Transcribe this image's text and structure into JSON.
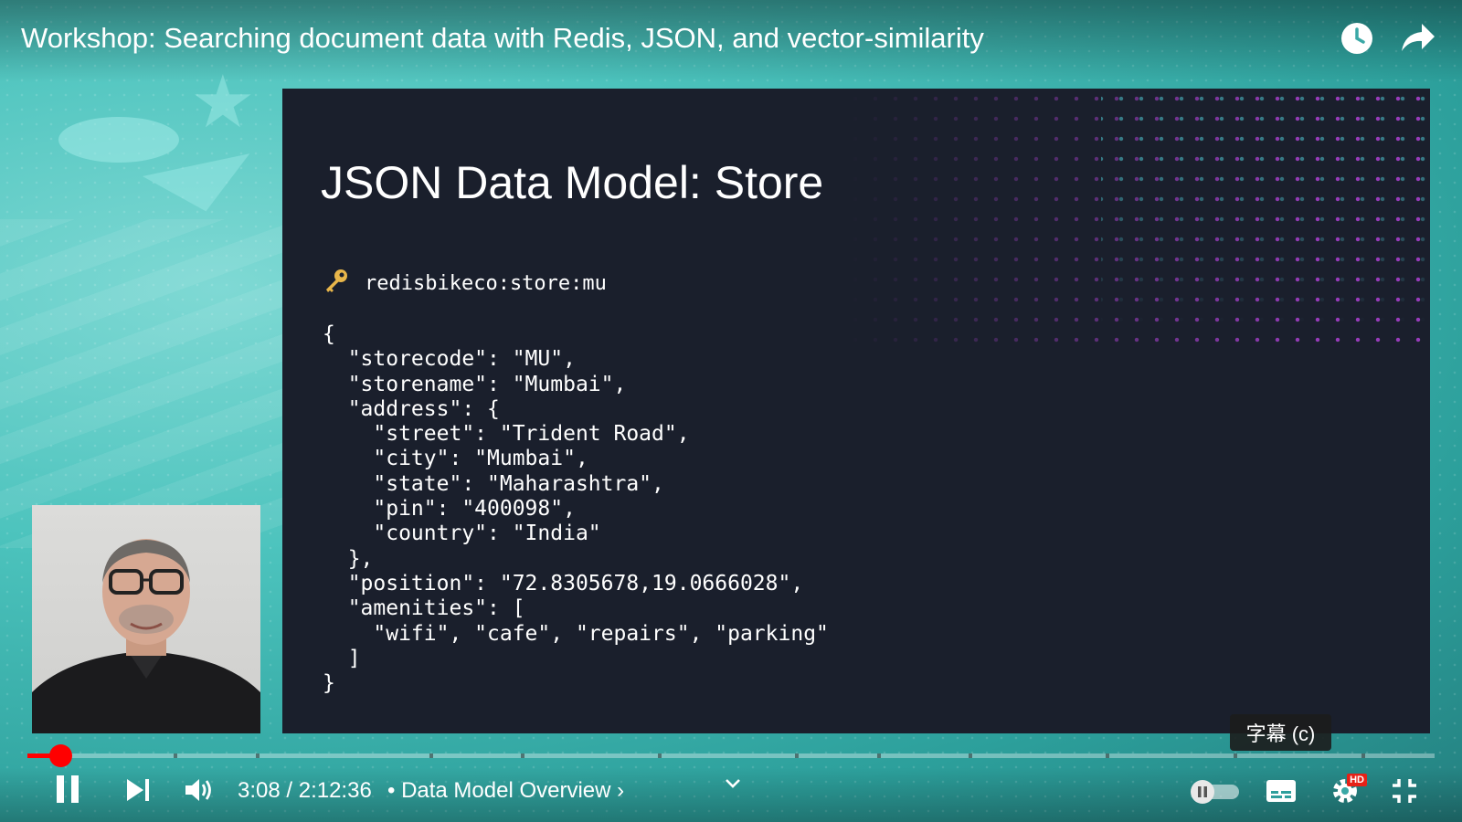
{
  "video": {
    "title": "Workshop: Searching document data with Redis, JSON, and vector-similarity"
  },
  "slide": {
    "title": "JSON Data Model: Store",
    "key_icon": "key-icon",
    "key_name": "redisbikeco:store:mu",
    "code": "{\n  \"storecode\": \"MU\",\n  \"storename\": \"Mumbai\",\n  \"address\": {\n    \"street\": \"Trident Road\",\n    \"city\": \"Mumbai\",\n    \"state\": \"Maharashtra\",\n    \"pin\": \"400098\",\n    \"country\": \"India\"\n  },\n  \"position\": \"72.8305678,19.0666028\",\n  \"amenities\": [\n    \"wifi\", \"cafe\", \"repairs\", \"parking\"\n  ]\n}"
  },
  "tooltip": {
    "text": "字幕 (c)"
  },
  "player": {
    "time": "3:08 / 2:12:36",
    "chapter": "• Data Model Overview ›",
    "progress_fraction": 0.0237,
    "autoplay": false,
    "accent_color": "#ff0000"
  },
  "icons": {
    "watch_later": "clock-icon",
    "share": "share-icon",
    "pause": "pause-icon",
    "next": "next-icon",
    "volume": "volume-icon",
    "chapter_expand": "chevron-down-icon",
    "autoplay": "autoplay-toggle-icon",
    "subtitles": "subtitles-icon",
    "settings": "gear-icon",
    "fullscreen_exit": "exit-fullscreen-icon"
  },
  "settings_badge": "HD"
}
